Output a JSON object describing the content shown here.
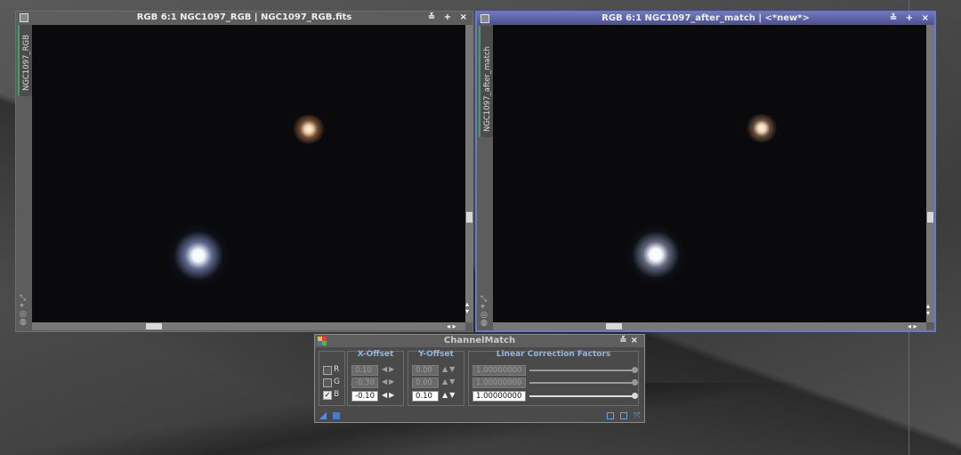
{
  "windows": [
    {
      "title": "RGB 6:1 NGC1097_RGB | NGC1097_RGB.fits",
      "side_label": "NGC1097_RGB",
      "active": false,
      "buttons": [
        "≚",
        "+",
        "×"
      ]
    },
    {
      "title": "RGB 6:1 NGC1097_after_match | <*new*>",
      "side_label": "NGC1097_after_match",
      "active": true,
      "buttons": [
        "≚",
        "+",
        "×"
      ]
    }
  ],
  "dialog": {
    "title": "ChannelMatch",
    "groups": {
      "x_offset": "X-Offset",
      "y_offset": "Y-Offset",
      "linear": "Linear Correction Factors"
    },
    "channels": [
      {
        "label": "R",
        "checked": false,
        "x_offset": "0.10",
        "y_offset": "0.00",
        "factor": "1.00000000",
        "slider_fraction": 1.0
      },
      {
        "label": "G",
        "checked": false,
        "x_offset": "-0.30",
        "y_offset": "0.00",
        "factor": "1.00000000",
        "slider_fraction": 1.0
      },
      {
        "label": "B",
        "checked": true,
        "x_offset": "-0.10",
        "y_offset": "0.10",
        "factor": "1.00000000",
        "slider_fraction": 1.0
      }
    ]
  },
  "colors": {
    "active_border": "#6c77c9",
    "group_title": "#8fb6e8",
    "side_tab_accent": "#3da26a"
  }
}
